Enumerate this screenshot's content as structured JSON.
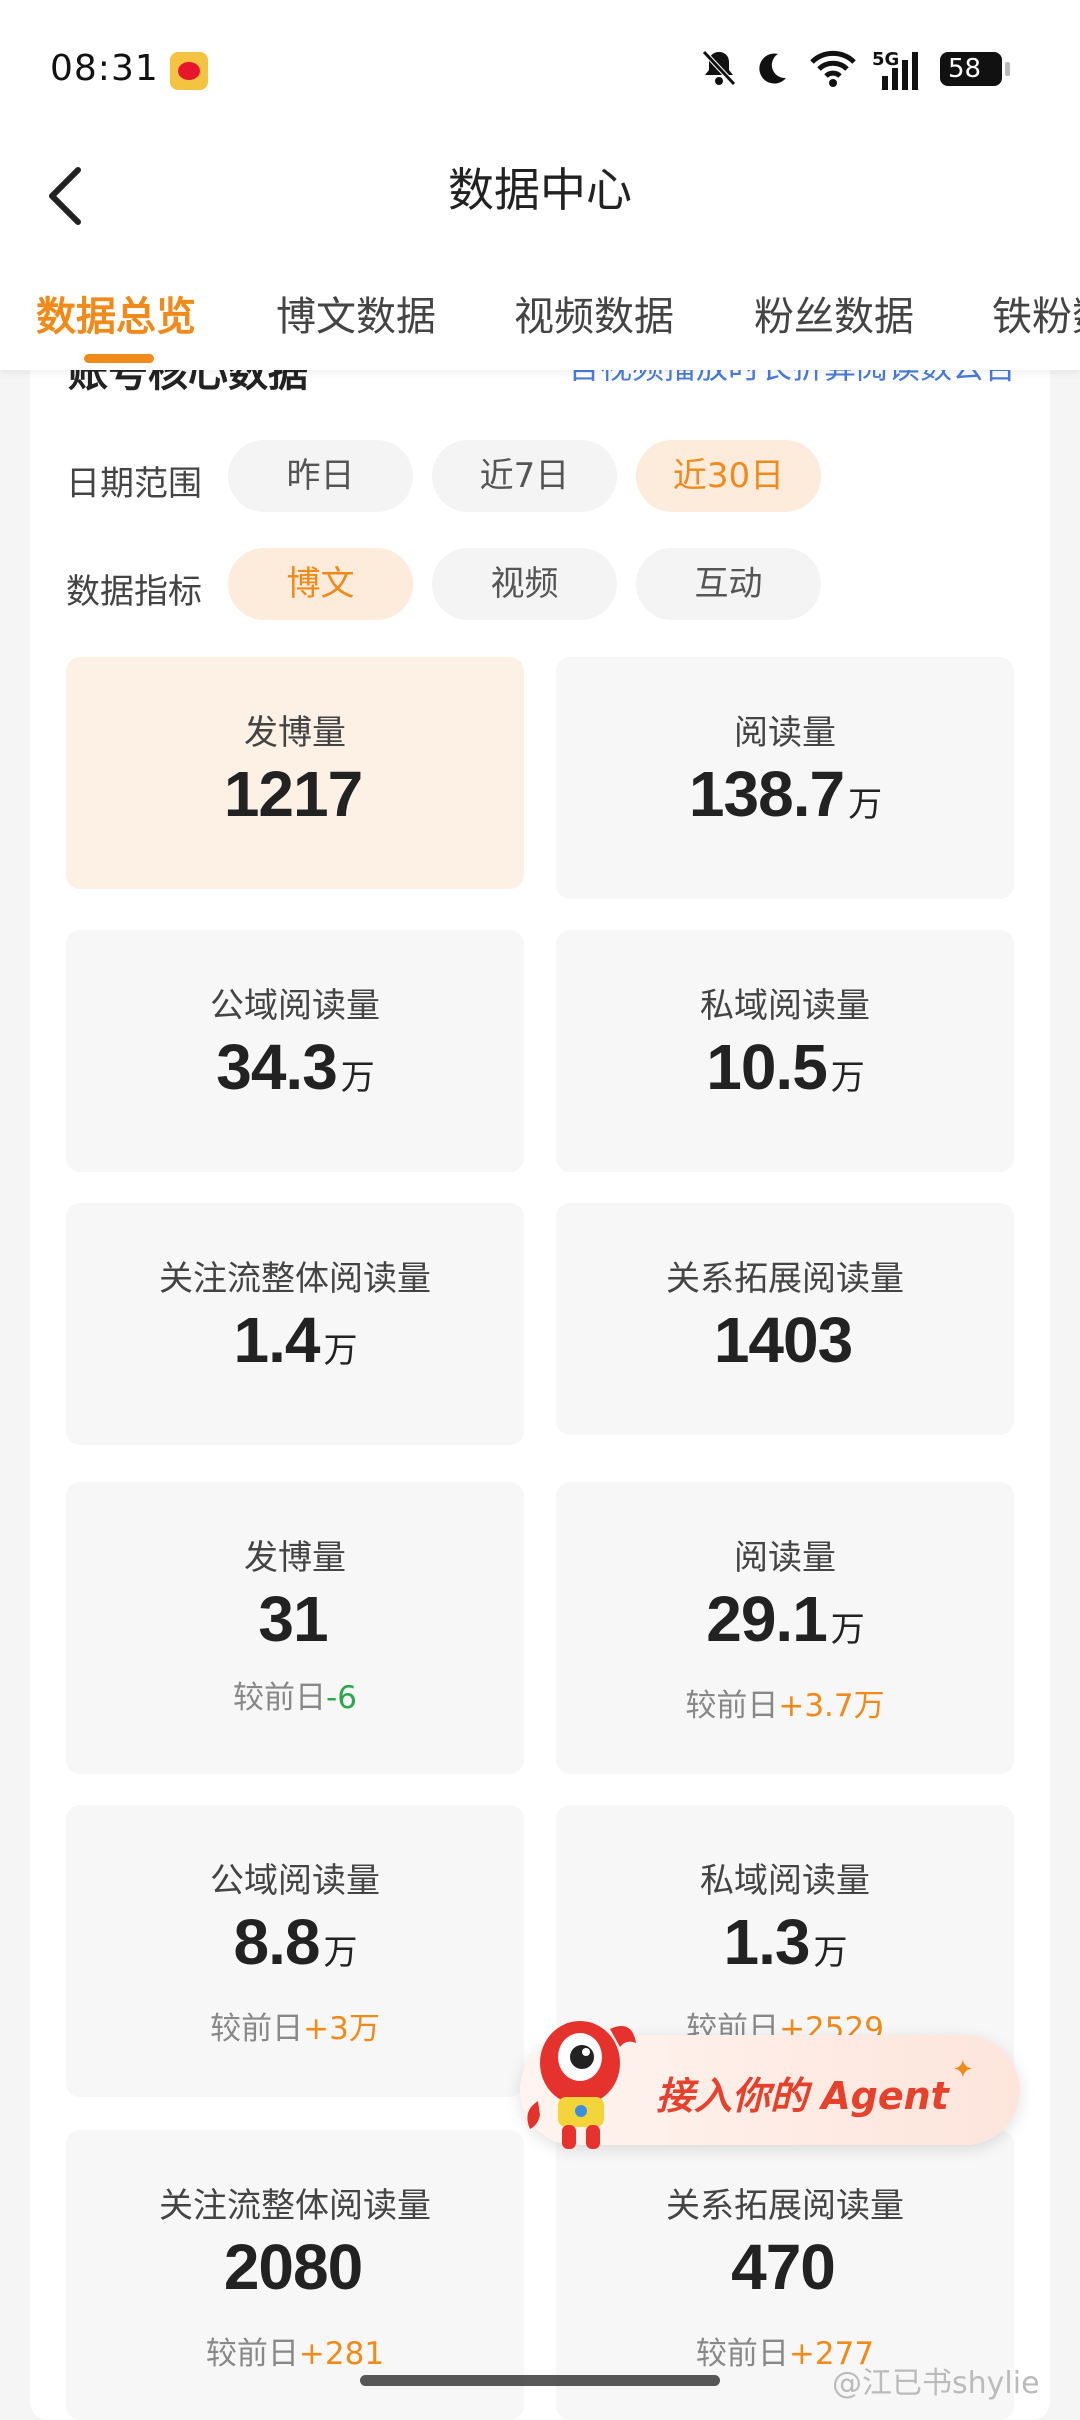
{
  "status_bar": {
    "time": "08:31",
    "network": "5G",
    "battery": "58",
    "icons": [
      "weibo-icon",
      "mute-icon",
      "moon-icon",
      "wifi-icon",
      "signal-icon",
      "battery-icon"
    ]
  },
  "nav": {
    "title": "数据中心",
    "back_icon": "back-arrow-icon"
  },
  "tabs": [
    {
      "label": "数据总览",
      "active": true
    },
    {
      "label": "博文数据",
      "active": false
    },
    {
      "label": "视频数据",
      "active": false
    },
    {
      "label": "粉丝数据",
      "active": false
    },
    {
      "label": "铁粉数",
      "active": false
    }
  ],
  "section": {
    "heading_partial": "账号核心数据",
    "link_partial": "含视频播放时长折算阅读数公告"
  },
  "filters": {
    "date_range_label": "日期范围",
    "date_options": [
      "昨日",
      "近7日",
      "近30日"
    ],
    "date_selected": "近30日",
    "metric_label": "数据指标",
    "metric_options": [
      "博文",
      "视频",
      "互动"
    ],
    "metric_selected": "博文"
  },
  "stats_30d": [
    {
      "label": "发博量",
      "value": "1217",
      "unit": ""
    },
    {
      "label": "阅读量",
      "value": "138.7",
      "unit": "万"
    },
    {
      "label": "公域阅读量",
      "value": "34.3",
      "unit": "万"
    },
    {
      "label": "私域阅读量",
      "value": "10.5",
      "unit": "万"
    },
    {
      "label": "关注流整体阅读量",
      "value": "1.4",
      "unit": "万"
    },
    {
      "label": "关系拓展阅读量",
      "value": "1403",
      "unit": ""
    }
  ],
  "stats_daily": [
    {
      "label": "发博量",
      "value": "31",
      "unit": "",
      "cmp_prefix": "较前日",
      "delta": "-6"
    },
    {
      "label": "阅读量",
      "value": "29.1",
      "unit": "万",
      "cmp_prefix": "较前日",
      "delta": "+3.7万"
    },
    {
      "label": "公域阅读量",
      "value": "8.8",
      "unit": "万",
      "cmp_prefix": "较前日",
      "delta": "+3万"
    },
    {
      "label": "私域阅读量",
      "value": "1.3",
      "unit": "万",
      "cmp_prefix": "较前日",
      "delta": "+2529"
    },
    {
      "label": "关注流整体阅读量",
      "value": "2080",
      "unit": "",
      "cmp_prefix": "较前日",
      "delta": "+281"
    },
    {
      "label": "关系拓展阅读量",
      "value": "470",
      "unit": "",
      "cmp_prefix": "较前日",
      "delta": "+277"
    }
  ],
  "agent_button": {
    "label": "接入你的 Agent",
    "icon": "mascot-icon"
  },
  "watermark": "@江已书shylie",
  "colors": {
    "accent": "#f08a1a",
    "highlight_bg": "#fdf0e4",
    "chip_on_bg": "#fdebdb",
    "delta_down": "#2ca84b",
    "link": "#4a7bd9",
    "agent_text": "#e5412d"
  }
}
